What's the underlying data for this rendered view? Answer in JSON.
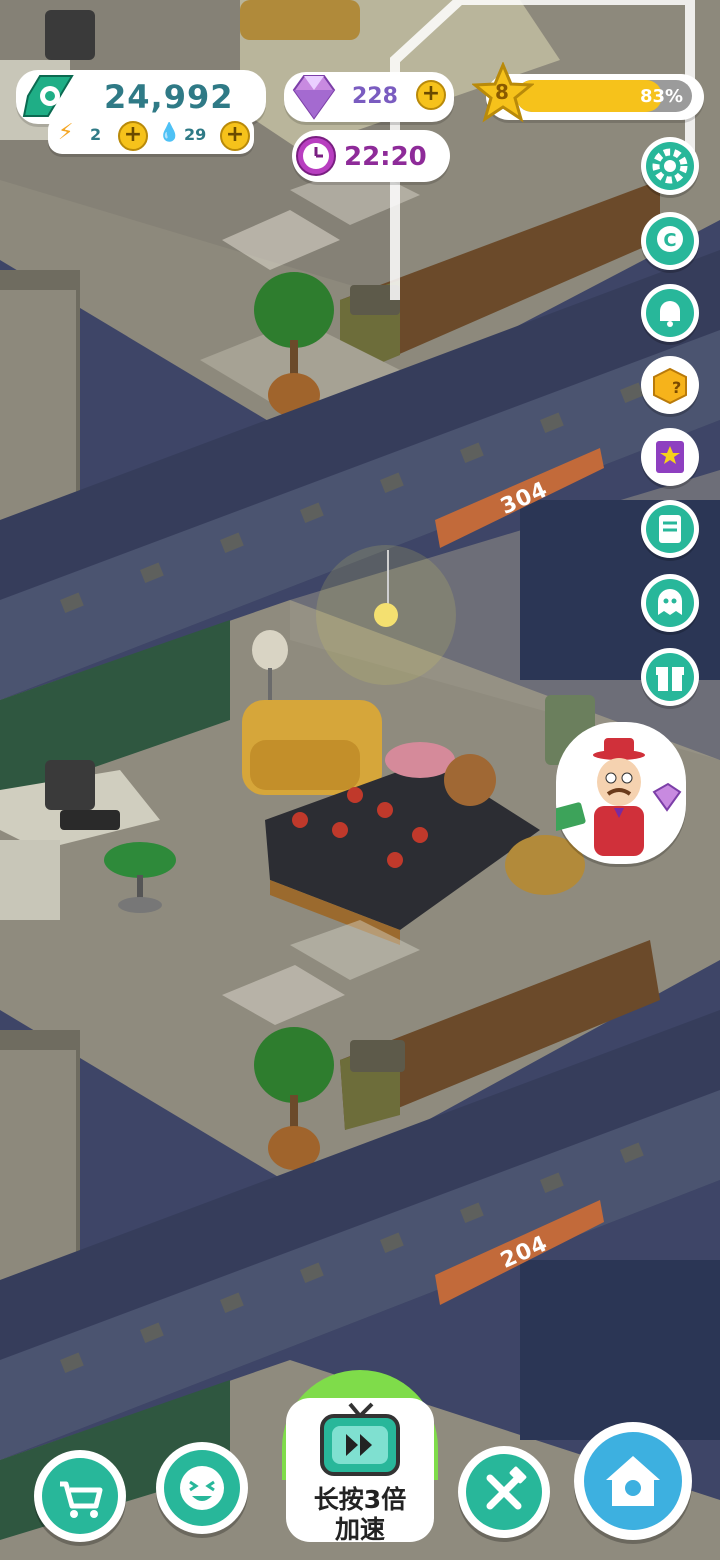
{
  "hud": {
    "cash": "24,992",
    "energy": "2",
    "water": "29",
    "gems": "228",
    "level": "8",
    "xp_percent": "83%",
    "xp_fraction": 0.83,
    "clock": "22:20",
    "plus_symbol": "+"
  },
  "rooms": {
    "upper_plate": "304",
    "lower_plate": "204"
  },
  "side_buttons": [
    {
      "name": "settings-gear-icon"
    },
    {
      "name": "coin-c-icon"
    },
    {
      "name": "bell-icon"
    },
    {
      "name": "mystery-box-icon"
    },
    {
      "name": "star-book-icon"
    },
    {
      "name": "notes-icon"
    },
    {
      "name": "ghost-chat-icon"
    },
    {
      "name": "gift-icon"
    }
  ],
  "bottom": {
    "speedup_line1": "长按3倍",
    "speedup_line2": "加速"
  },
  "colors": {
    "teal": "#28b79a",
    "gold": "#f6c21b",
    "purple": "#b83ec0",
    "wall": "#3b4366",
    "floor": "#8e8a7e"
  }
}
